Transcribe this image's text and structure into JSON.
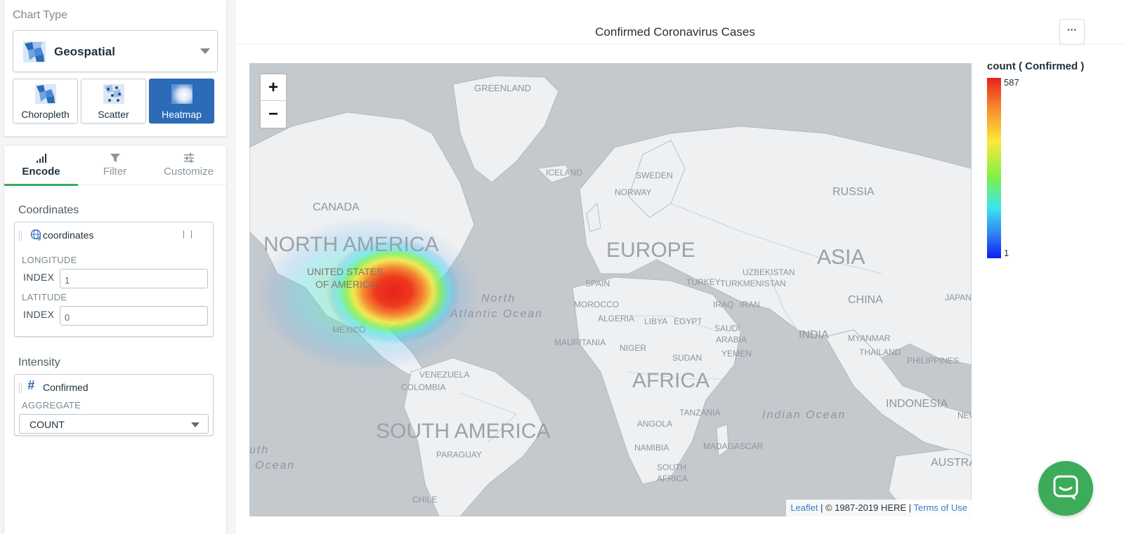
{
  "chart_type_panel": {
    "title": "Chart Type",
    "selected_type": "Geospatial",
    "subtypes": [
      {
        "label": "Choropleth",
        "active": false
      },
      {
        "label": "Scatter",
        "active": false
      },
      {
        "label": "Heatmap",
        "active": true
      }
    ]
  },
  "tabs": [
    {
      "label": "Encode",
      "icon": "bars-signal-icon",
      "active": true
    },
    {
      "label": "Filter",
      "icon": "funnel-icon",
      "active": false
    },
    {
      "label": "Customize",
      "icon": "sliders-icon",
      "active": false
    }
  ],
  "coordinates": {
    "section_title": "Coordinates",
    "field": "coordinates",
    "longitude_label": "LONGITUDE",
    "longitude_index_label": "INDEX",
    "longitude_index": "1",
    "latitude_label": "LATITUDE",
    "latitude_index_label": "INDEX",
    "latitude_index": "0"
  },
  "intensity": {
    "section_title": "Intensity",
    "field": "Confirmed",
    "aggregate_label": "AGGREGATE",
    "aggregate_value": "COUNT"
  },
  "chart": {
    "title": "Confirmed Coronavirus Cases",
    "more_label": "···"
  },
  "map": {
    "zoom_in": "+",
    "zoom_out": "−",
    "labels": {
      "greenland": "GREENLAND",
      "iceland": "ICELAND",
      "sweden": "SWEDEN",
      "norway": "NORWAY",
      "russia": "RUSSIA",
      "canada": "CANADA",
      "north_america": "NORTH AMERICA",
      "europe": "EUROPE",
      "asia": "ASIA",
      "united_states": "UNITED STATES",
      "of_america": "OF AMERICA",
      "spain": "SPAIN",
      "turkey": "TURKEY",
      "turkmenistan": "TURKMENISTAN",
      "uzbekistan": "UZBEKISTAN",
      "china": "CHINA",
      "japan": "JAPAN",
      "north_atlantic_1": "North",
      "north_atlantic_2": "Atlantic Ocean",
      "morocco": "MOROCCO",
      "algeria": "ALGERIA",
      "libya": "LIBYA",
      "egypt": "EGYPT",
      "iraq": "IRAQ",
      "iran": "IRAN",
      "mexico": "MEXICO",
      "saudi_1": "SAUDI",
      "saudi_2": "ARABIA",
      "india": "INDIA",
      "myanmar": "MYANMAR",
      "thailand": "THAILAND",
      "yemen": "YEMEN",
      "mauritania": "MAURITANIA",
      "niger": "NIGER",
      "sudan": "SUDAN",
      "philippines": "PHILIPPINES",
      "venezuela": "VENEZUELA",
      "colombia": "COLOMBIA",
      "africa": "AFRICA",
      "tanzania": "TANZANIA",
      "indian_ocean": "Indian Ocean",
      "indonesia": "INDONESIA",
      "south_america": "SOUTH AMERICA",
      "angola": "ANGOLA",
      "namibia": "NAMIBIA",
      "madagascar": "MADAGASCAR",
      "paraguay": "PARAGUAY",
      "south_africa_1": "SOUTH",
      "south_africa_2": "AFRICA",
      "australia": "AUSTRAL",
      "south_ocean_1": "uth",
      "south_ocean_2": "Ocean",
      "chile": "CHILE",
      "new": "NEW"
    },
    "attribution_link": "Leaflet",
    "attribution_text": " | © 1987-2019 HERE | ",
    "terms_link": "Terms of Use"
  },
  "legend": {
    "title": "count ( Confirmed )",
    "max": "587",
    "min": "1",
    "colors": [
      "#e8201c",
      "#f7812b",
      "#fde83b",
      "#7ef246",
      "#3be5f0",
      "#2e78f2",
      "#0c1ff0"
    ]
  },
  "accent_colors": {
    "active_tab": "#3cac5a",
    "active_subtype": "#2b6bb8",
    "chat": "#3cac5a"
  }
}
